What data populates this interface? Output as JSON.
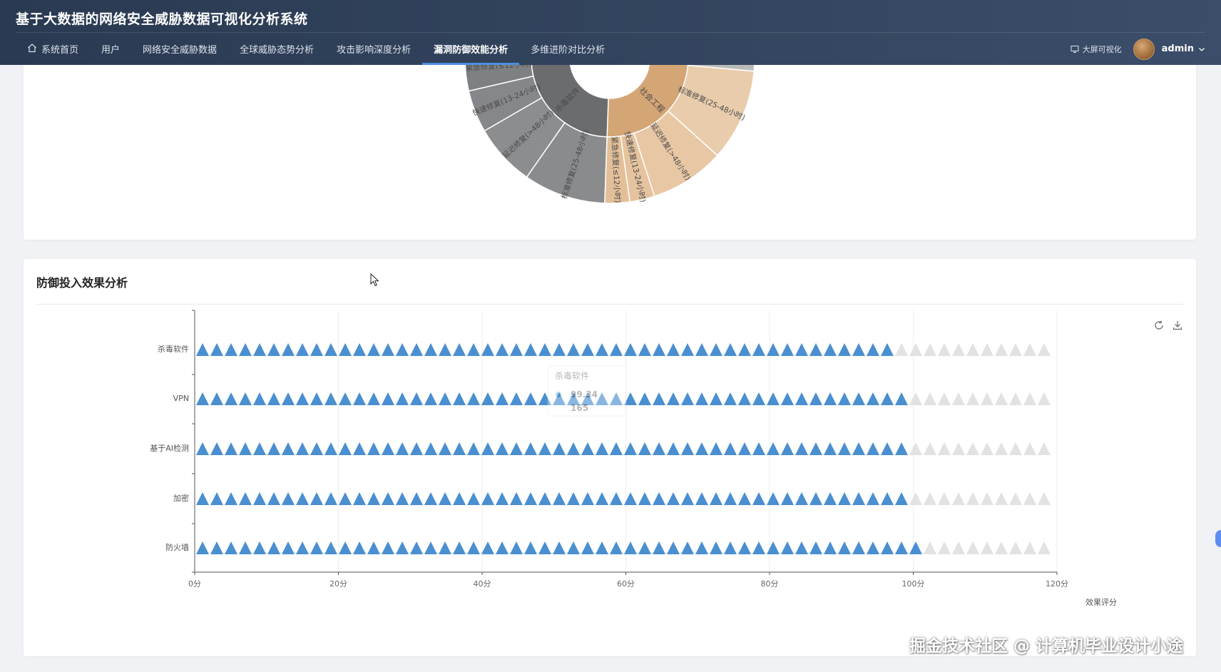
{
  "header": {
    "title": "基于大数据的网络安全威胁数据可视化分析系统",
    "nav": [
      {
        "label": "系统首页",
        "icon": "home-icon",
        "active": false
      },
      {
        "label": "用户",
        "active": false
      },
      {
        "label": "网络安全威胁数据",
        "active": false
      },
      {
        "label": "全球威胁态势分析",
        "active": false
      },
      {
        "label": "攻击影响深度分析",
        "active": false
      },
      {
        "label": "漏洞防御效能分析",
        "active": true
      },
      {
        "label": "多维进阶对比分析",
        "active": false
      }
    ],
    "bigscreen_label": "大屏可视化",
    "username": "admin"
  },
  "sunburst": {
    "inner": [
      {
        "label": "杀毒软件",
        "color": "#6b6c6e"
      },
      {
        "label": "社会工程",
        "color": "#d4a575"
      }
    ],
    "outer": [
      {
        "label": "紧急修复(≤12小时)",
        "color": "#7f8082"
      },
      {
        "label": "快速修复(13-24小时)",
        "color": "#86878a"
      },
      {
        "label": "延迟修复(>48小时)",
        "color": "#8c8d8f"
      },
      {
        "label": "标准修复(25-48小时)",
        "color": "#8a8b8d"
      },
      {
        "label": "紧急修复(≤12小时)",
        "color": "#e3bf98"
      },
      {
        "label": "快速修复(13-24小时)",
        "color": "#e5c39e"
      },
      {
        "label": "延迟修复(>48小时)",
        "color": "#e8c8a4"
      },
      {
        "label": "标准修复(25-48小时)",
        "color": "#e9ccab"
      }
    ]
  },
  "panel": {
    "title": "防御投入效果分析",
    "toolbox": [
      "restore-icon",
      "save-image-icon"
    ]
  },
  "chart_data": {
    "type": "bar",
    "subtype": "pictorial-bar",
    "symbol": "triangle",
    "categories": [
      "杀毒软件",
      "VPN",
      "基于AI检测",
      "加密",
      "防火墙"
    ],
    "series": [
      {
        "values": [
          98,
          100,
          100,
          100,
          101
        ],
        "color": "#4a8fd0"
      }
    ],
    "background_symbol_color": "#e2e2e2",
    "xlim": [
      0,
      120
    ],
    "xticks": [
      "0分",
      "20分",
      "40分",
      "60分",
      "80分",
      "100分",
      "120分"
    ],
    "xlabel": "效果评分",
    "ylabel": "",
    "grid": true,
    "tooltip": {
      "title": "杀毒软件",
      "value": "99.34",
      "value2": "165"
    }
  },
  "watermark": "掘金技术社区 @ 计算机毕业设计小途"
}
